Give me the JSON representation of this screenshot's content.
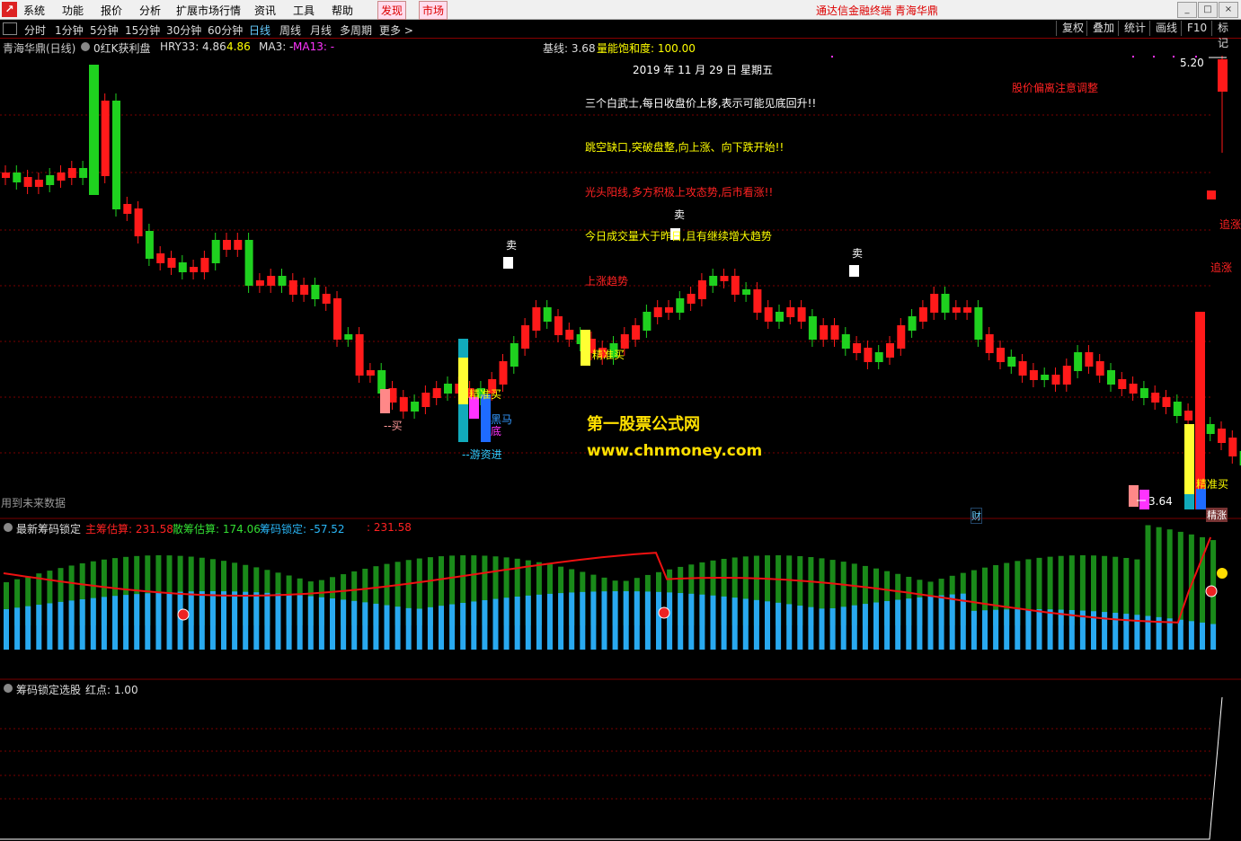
{
  "menubar": {
    "items": [
      "系统",
      "功能",
      "报价",
      "分析",
      "扩展市场行情",
      "资讯",
      "工具",
      "帮助"
    ],
    "highlight": [
      "发现",
      "市场"
    ],
    "brand": "通达信金融终端  青海华鼎",
    "win_buttons": [
      "_",
      "□",
      "×"
    ]
  },
  "periodbar": {
    "items": [
      "分时",
      "1分钟",
      "5分钟",
      "15分钟",
      "30分钟",
      "60分钟",
      "日线",
      "周线",
      "月线",
      "多周期",
      "更多 >"
    ],
    "active": "日线",
    "tools": [
      "复权",
      "叠加",
      "统计",
      "画线",
      "F10",
      "标记"
    ]
  },
  "main_panel": {
    "title": "青海华鼎(日线)",
    "indicator": "0红K获利盘",
    "hry_label": "HRY33: 4.86",
    "hry_val2": "4.86",
    "ma3": "MA3: -",
    "ma13": "MA13: -",
    "jixian": "基线: 3.68",
    "nengliang": "量能饱和度: 100.00",
    "date": "2019 年 11 月 29 日 星期五",
    "price_high": "5.20",
    "price_low": "3.64",
    "future_data": "用到未来数据",
    "cai": "财"
  },
  "annotations": {
    "line1": "三个白武士,每日收盘价上移,表示可能见底回升!!",
    "line2": "跳空缺口,突破盘整,向上涨、向下跌开始!!",
    "line3": "光头阳线,多方积极上攻态势,后市看涨!!",
    "line4": "今日成交量大于昨日,且有继续增大趋势",
    "warn": "股价偏离注意调整",
    "zhuizhang": "追涨",
    "shangzhang": "上涨趋势",
    "sell": "卖",
    "buy": "--买",
    "jingzhunmai": "精准买",
    "heima": "黑马",
    "di": "底",
    "youzi": "--游资进",
    "jingzhang": "精涨",
    "watermark1": "第一股票公式网",
    "watermark2": "www.chnmoney.com"
  },
  "chip_panel": {
    "title": "最新筹码锁定",
    "zhu": "主筹估算: 231.58",
    "san": "散筹估算: 174.06",
    "lock": "筹码锁定: -57.52",
    "extra": ": 231.58"
  },
  "select_panel": {
    "title": "筹码锁定选股",
    "red": "红点: 1.00"
  },
  "colors": {
    "up": "#ff1a1a",
    "down": "#1fd11f",
    "yellow": "#ffff33",
    "cyan": "#29b6f6",
    "magenta": "#ff33ff",
    "divider": "#7a0000"
  }
}
